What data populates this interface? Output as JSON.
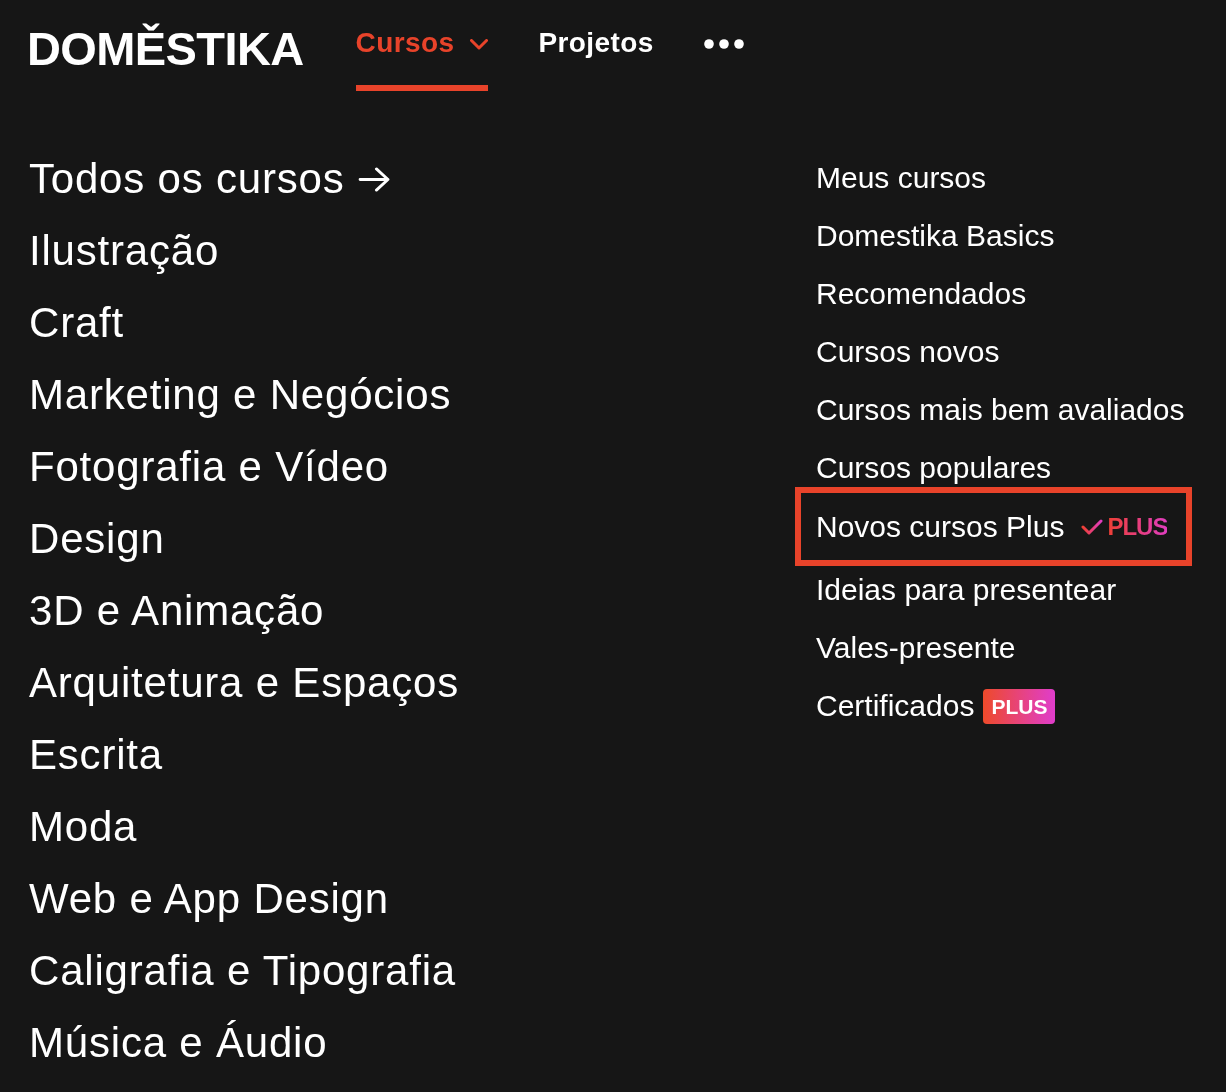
{
  "logo": {
    "text": "DOMĚSTIKA"
  },
  "nav": {
    "tabs": [
      {
        "label": "Cursos",
        "kind": "dropdown",
        "selected": true
      },
      {
        "label": "Projetos",
        "kind": "link",
        "selected": false
      }
    ],
    "more_menu": {
      "kind": "dots"
    }
  },
  "categories": [
    {
      "label": "Todos os cursos",
      "kind": "all"
    },
    {
      "label": "Ilustração",
      "kind": "category"
    },
    {
      "label": "Craft",
      "kind": "category"
    },
    {
      "label": "Marketing e Negócios",
      "kind": "category"
    },
    {
      "label": "Fotografia e Vídeo",
      "kind": "category"
    },
    {
      "label": "Design",
      "kind": "category"
    },
    {
      "label": "3D e Animação",
      "kind": "category"
    },
    {
      "label": "Arquitetura e Espaços",
      "kind": "category"
    },
    {
      "label": "Escrita",
      "kind": "category"
    },
    {
      "label": "Moda",
      "kind": "category"
    },
    {
      "label": "Web e App Design",
      "kind": "category"
    },
    {
      "label": "Caligrafia e Tipografia",
      "kind": "category"
    },
    {
      "label": "Música e Áudio",
      "kind": "category"
    }
  ],
  "quick_links": [
    {
      "label": "Meus cursos",
      "highlighted": false
    },
    {
      "label": "Domestika Basics",
      "highlighted": false
    },
    {
      "label": "Recomendados",
      "highlighted": false
    },
    {
      "label": "Cursos novos",
      "highlighted": false
    },
    {
      "label": "Cursos mais bem avaliados",
      "highlighted": false
    },
    {
      "label": "Cursos populares",
      "highlighted": false
    },
    {
      "label": "Novos cursos Plus",
      "highlighted": true,
      "badge": {
        "kind": "plus_logo",
        "text": "PLUS"
      }
    },
    {
      "label": "Ideias para presentear",
      "highlighted": false
    },
    {
      "label": "Vales-presente",
      "highlighted": false
    },
    {
      "label": "Certificados",
      "highlighted": false,
      "badge": {
        "kind": "plus_tag",
        "text": "PLUS"
      }
    }
  ]
}
